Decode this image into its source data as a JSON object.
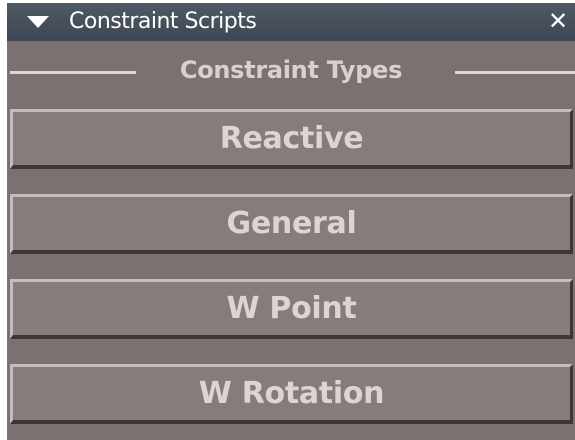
{
  "window": {
    "title": "Constraint Scripts",
    "collapse_icon": "triangle-down-icon",
    "close_glyph": "✕",
    "close_icon": "close-icon"
  },
  "section": {
    "title": "Constraint Types"
  },
  "buttons": [
    {
      "label": "Reactive"
    },
    {
      "label": "General"
    },
    {
      "label": "W Point"
    },
    {
      "label": "W Rotation"
    }
  ],
  "colors": {
    "panel_bg": "#7a7270",
    "titlebar_bg": "#46505b",
    "button_face": "#857d7b",
    "text": "#ddd5d3"
  }
}
